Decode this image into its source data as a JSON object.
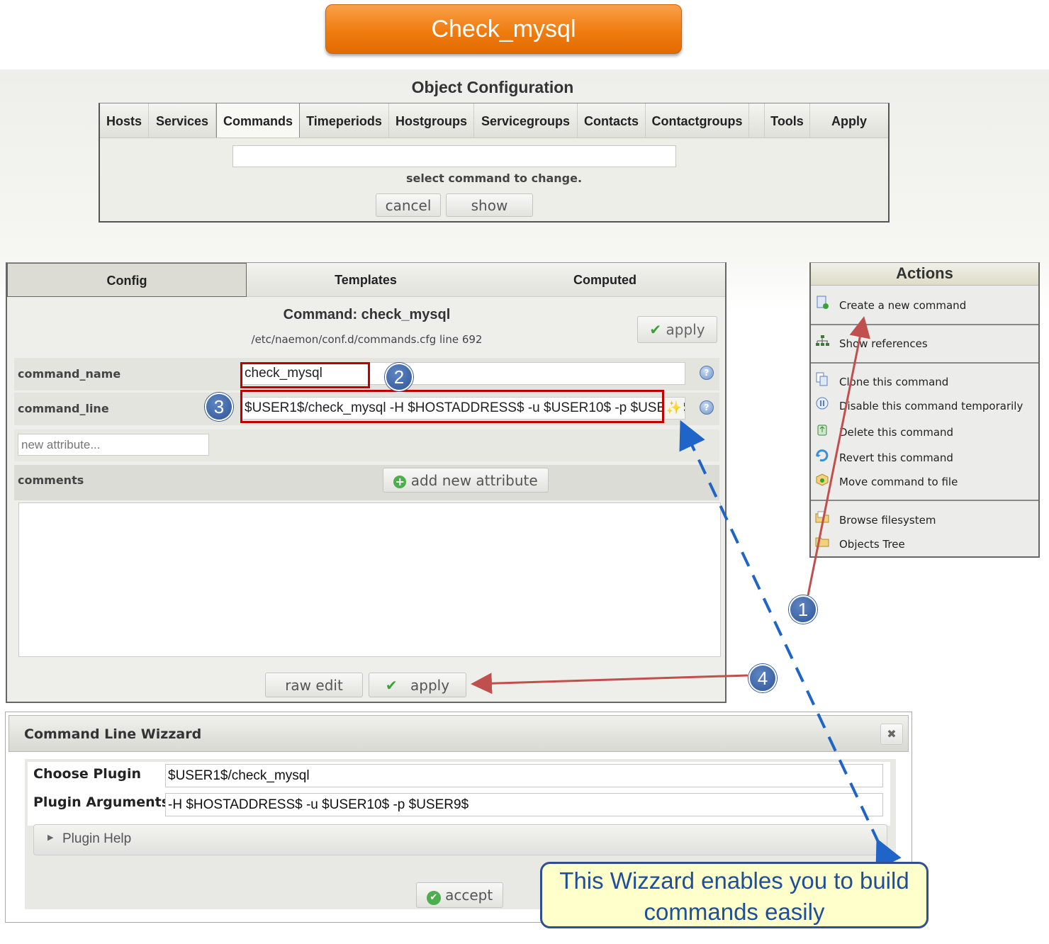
{
  "banner": {
    "title": "Check_mysql"
  },
  "object_configuration": {
    "title": "Object Configuration",
    "nav": [
      "Hosts",
      "Services",
      "Commands",
      "Timeperiods",
      "Hostgroups",
      "Servicegroups",
      "Contacts",
      "Contactgroups",
      "Tools",
      "Apply"
    ],
    "active_nav": "Commands",
    "hint": "select command to change.",
    "cancel_label": "cancel",
    "show_label": "show"
  },
  "config_panel": {
    "tabs": [
      "Config",
      "Templates",
      "Computed"
    ],
    "active_tab": "Config",
    "heading": "Command: check_mysql",
    "path": "/etc/naemon/conf.d/commands.cfg line 692",
    "apply_label": "apply",
    "fields": {
      "command_name_label": "command_name",
      "command_name_value": "check_mysql",
      "command_line_label": "command_line",
      "command_line_value": "$USER1$/check_mysql -H $HOSTADDRESS$ -u $USER10$  -p $USER9$",
      "new_attribute_placeholder": "new attribute...",
      "comments_label": "comments",
      "add_attribute_label": "add new attribute"
    },
    "raw_edit_label": "raw edit",
    "bottom_apply_label": "apply"
  },
  "actions": {
    "title": "Actions",
    "groups": [
      [
        {
          "label": "Create a new command",
          "icon": "new-document-icon"
        }
      ],
      [
        {
          "label": "Show references",
          "icon": "sitemap-icon"
        }
      ],
      [
        {
          "label": "Clone this command",
          "icon": "clone-icon"
        },
        {
          "label": "Disable this command temporarily",
          "icon": "pause-icon"
        },
        {
          "label": "Delete this command",
          "icon": "recycle-icon"
        },
        {
          "label": "Revert this command",
          "icon": "revert-icon"
        },
        {
          "label": "Move command to file",
          "icon": "move-box-icon"
        }
      ],
      [
        {
          "label": "Browse filesystem",
          "icon": "folder-browse-icon"
        },
        {
          "label": "Objects Tree",
          "icon": "folder-tree-icon"
        }
      ]
    ]
  },
  "wizard": {
    "title": "Command Line Wizzard",
    "close_symbol": "✖",
    "choose_plugin_label": "Choose Plugin",
    "choose_plugin_value": "$USER1$/check_mysql",
    "plugin_arguments_label": "Plugin Arguments",
    "plugin_arguments_value": "-H $HOSTADDRESS$ -u $USER10$  -p $USER9$",
    "plugin_help_label": "Plugin Help",
    "accept_label": "accept"
  },
  "annotations": {
    "markers": [
      "1",
      "2",
      "3",
      "4"
    ],
    "callout": "This Wizzard enables you to build commands easily",
    "colors": {
      "red_box": "#c00000",
      "marker_blue": "#2f5597",
      "arrow_red": "#c0504d",
      "dashed_blue": "#1f64c8",
      "banner_orange": "#f07c10"
    }
  }
}
